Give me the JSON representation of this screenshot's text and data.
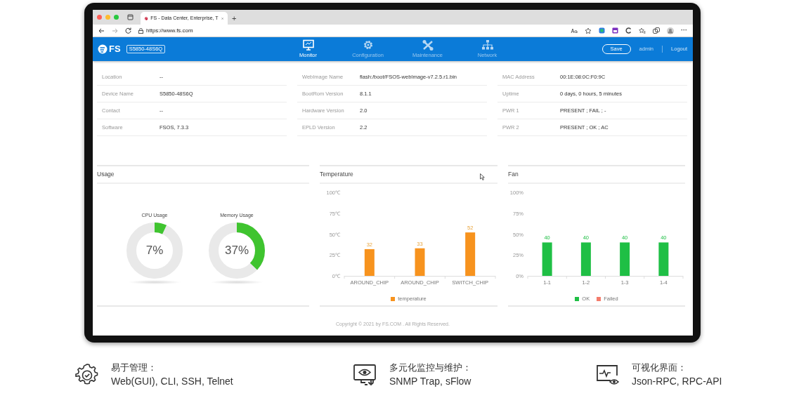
{
  "browser": {
    "tab_title": "FS - Data Center, Enterprise, T",
    "new_tab": "+",
    "url": "https://www.fs.com",
    "more": "···"
  },
  "header": {
    "logo": "FS",
    "model": "S5850-48S6Q",
    "nav": [
      {
        "label": "Monitor",
        "selected": true
      },
      {
        "label": "Configuration",
        "selected": false
      },
      {
        "label": "Maintenance",
        "selected": false
      },
      {
        "label": "Network",
        "selected": false
      }
    ],
    "save": "Save",
    "user": "admin",
    "logout": "Logout"
  },
  "info_columns": [
    [
      {
        "label": "Location",
        "value": "--"
      },
      {
        "label": "Device Name",
        "value": "S5850-48S6Q"
      },
      {
        "label": "Contact",
        "value": "--"
      },
      {
        "label": "Software",
        "value": "FSOS, 7.3.3"
      }
    ],
    [
      {
        "label": "WebImage Name",
        "value": "flash:/boot/FSOS-webImage-v7.2.5.r1.bin"
      },
      {
        "label": "BootRom Version",
        "value": "8.1.1"
      },
      {
        "label": "Hardware Version",
        "value": "2.0"
      },
      {
        "label": "EPLD Version",
        "value": "2.2"
      }
    ],
    [
      {
        "label": "MAC Address",
        "value": "00:1E:08:0C:F0:9C"
      },
      {
        "label": "Uptime",
        "value": "0 days, 0 hours, 5 minutes"
      },
      {
        "label": "PWR 1",
        "value": "PRESENT ; FAIL ; -"
      },
      {
        "label": "PWR 2",
        "value": "PRESENT ; OK ; AC"
      }
    ]
  ],
  "usage": {
    "title": "Usage",
    "gauges": [
      {
        "label": "CPU Usage",
        "reading": "7%",
        "level": 0.07
      },
      {
        "label": "Memory Usage",
        "reading": "37%",
        "level": 0.37
      }
    ]
  },
  "temperature": {
    "title": "Temperature",
    "chart_data": {
      "type": "bar",
      "categories": [
        "AROUND_CHIP",
        "AROUND_CHIP",
        "SWITCH_CHIP"
      ],
      "series": [
        {
          "name": "temperature",
          "color": "#f7931e",
          "values": [
            32,
            33,
            52
          ]
        }
      ],
      "ylim": [
        0,
        100
      ],
      "yticks": [
        {
          "value": 0,
          "label": "0℃"
        },
        {
          "value": 25,
          "label": "25℃"
        },
        {
          "value": 50,
          "label": "50℃"
        },
        {
          "value": 75,
          "label": "75℃"
        },
        {
          "value": 100,
          "label": "100℃"
        }
      ],
      "data_labels": true
    }
  },
  "fan": {
    "title": "Fan",
    "chart_data": {
      "type": "bar",
      "categories": [
        "1-1",
        "1-2",
        "1-3",
        "1-4"
      ],
      "series": [
        {
          "name": "OK",
          "color": "#1fbf45",
          "values": [
            40,
            40,
            40,
            40
          ]
        },
        {
          "name": "Failed",
          "color": "#f47c6c",
          "values": [
            null,
            null,
            null,
            null
          ]
        }
      ],
      "ylim": [
        0,
        100
      ],
      "yticks": [
        {
          "value": 0,
          "label": "0%"
        },
        {
          "value": 25,
          "label": "25%"
        },
        {
          "value": 50,
          "label": "50%"
        },
        {
          "value": 75,
          "label": "75%"
        },
        {
          "value": 100,
          "label": "100%"
        }
      ],
      "data_labels": true
    }
  },
  "copyright": "Copyright © 2021 by FS.COM . All Rights Reserved.",
  "features": [
    {
      "kind": "manage",
      "title": "易于管理：",
      "text": "Web(GUI), CLI, SSH, Telnet"
    },
    {
      "kind": "monitor",
      "title": "多元化监控与维护：",
      "text": "SNMP Trap, sFlow"
    },
    {
      "kind": "visual",
      "title": "可视化界面：",
      "text": "Json-RPC, RPC-API"
    }
  ]
}
